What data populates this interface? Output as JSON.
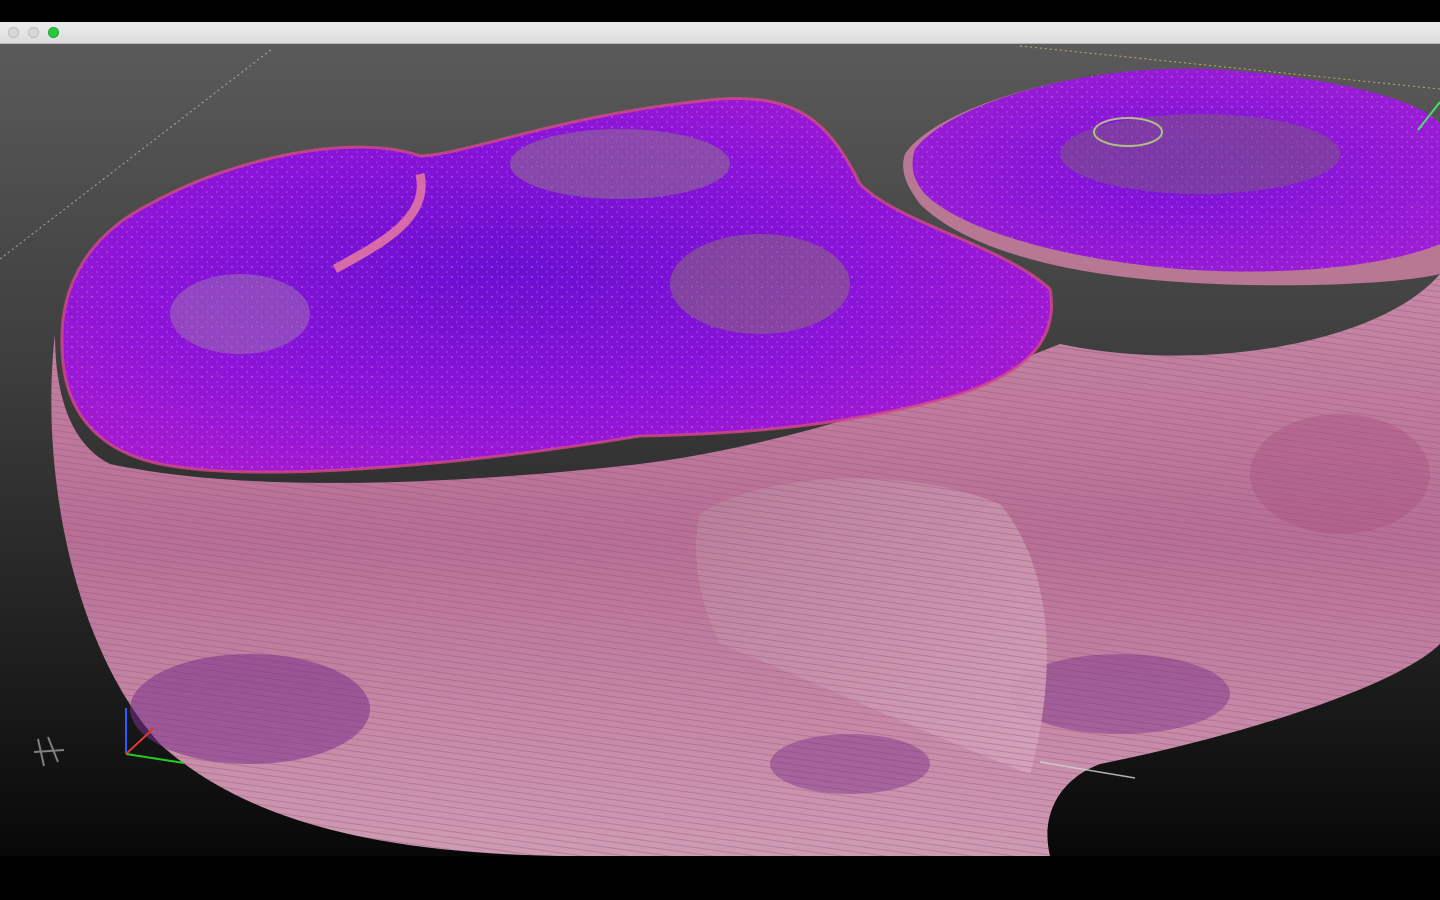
{
  "window": {
    "title": "",
    "buttons": {
      "close": "close-button",
      "minimize": "minimize-button",
      "zoom": "zoom-button"
    },
    "zoom_color": "#27c93f"
  },
  "viewer": {
    "content": "3d-volume-render",
    "stain_colors": {
      "nuclei": "#7a10d8",
      "stroma": "#c98aa8",
      "edge": "#d34a86"
    },
    "axis_gizmo": {
      "x_color": "#1fd01f",
      "y_color": "#2a5cff",
      "z_color": "#e03a2a"
    }
  }
}
